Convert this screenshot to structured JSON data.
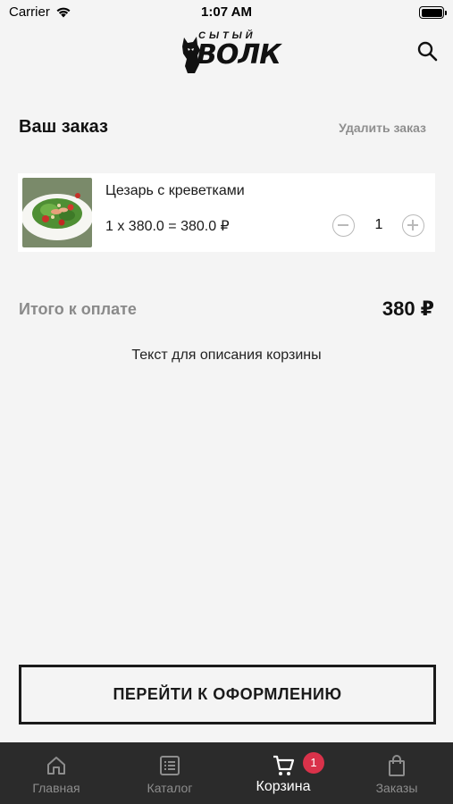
{
  "status_bar": {
    "carrier": "Carrier",
    "time": "1:07 AM"
  },
  "header": {
    "logo_small": "СЫТЫЙ",
    "logo_big": "ВОЛК"
  },
  "order": {
    "title": "Ваш заказ",
    "delete_label": "Удалить заказ"
  },
  "items": [
    {
      "name": "Цезарь с креветками",
      "price_line": "1 x 380.0 = 380.0 ₽",
      "quantity": "1"
    }
  ],
  "total": {
    "label": "Итого к оплате",
    "value": "380 ₽"
  },
  "cart_description": "Текст для описания корзины",
  "checkout_label": "ПЕРЕЙТИ К ОФОРМЛЕНИЮ",
  "tabs": [
    {
      "label": "Главная",
      "icon": "home-icon",
      "active": false
    },
    {
      "label": "Каталог",
      "icon": "catalog-icon",
      "active": false
    },
    {
      "label": "Корзина",
      "icon": "cart-icon",
      "active": true
    },
    {
      "label": "Заказы",
      "icon": "bag-icon",
      "active": false
    }
  ],
  "cart_badge": "1",
  "colors": {
    "background": "#f4f4f4",
    "tab_bar": "#2b2b2b",
    "badge": "#d9324a",
    "muted": "#8a8a8a"
  }
}
